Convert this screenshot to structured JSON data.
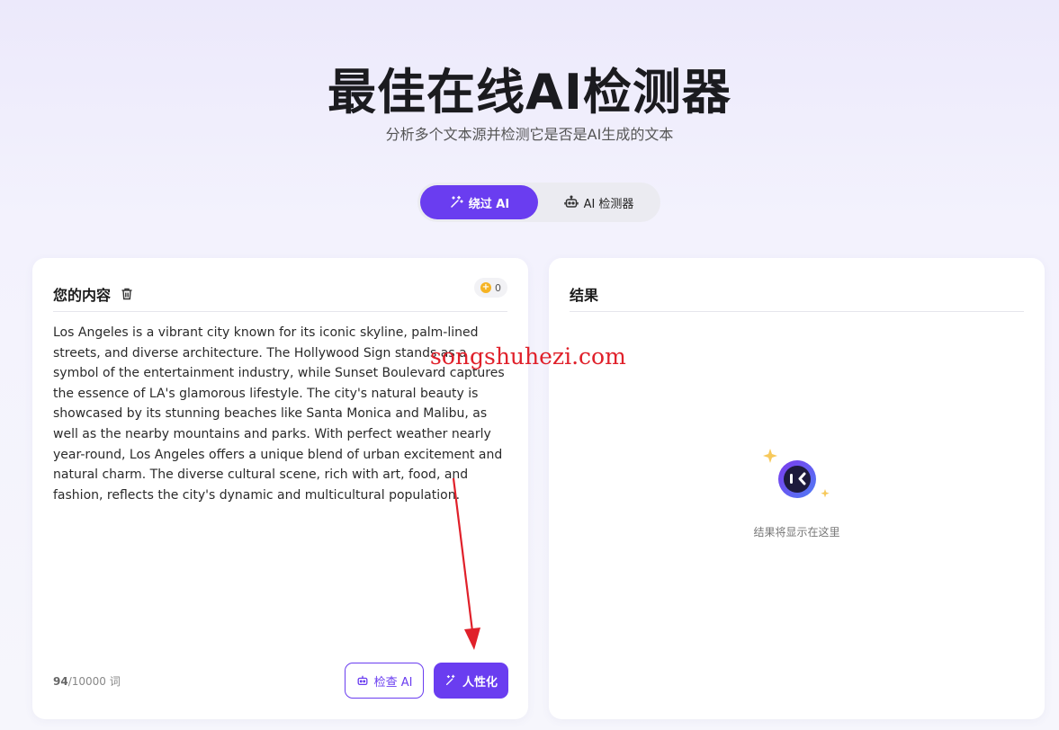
{
  "hero": {
    "title": "最佳在线AI检测器",
    "subtitle": "分析多个文本源并检测它是否是AI生成的文本"
  },
  "mode_toggle": {
    "bypass_label": "绕过 AI",
    "detector_label": "AI 检测器",
    "active": "bypass"
  },
  "input_card": {
    "title": "您的内容",
    "credits": "0",
    "text": "Los Angeles is a vibrant city known for its iconic skyline, palm-lined streets, and diverse architecture. The Hollywood Sign stands as a symbol of the entertainment industry, while Sunset Boulevard captures the essence of LA's glamorous lifestyle. The city's natural beauty is showcased by its stunning beaches like Santa Monica and Malibu, as well as the nearby mountains and parks. With perfect weather nearly year-round, Los Angeles offers a unique blend of urban excitement and natural charm. The diverse cultural scene, rich with art, food, and fashion, reflects the city's dynamic and multicultural population.",
    "word_count": "94",
    "word_limit": "/10000 词",
    "check_ai_label": "检查 AI",
    "humanize_label": "人性化"
  },
  "result_card": {
    "title": "结果",
    "empty_text": "结果将显示在这里"
  },
  "watermark": "songshuhezi.com",
  "colors": {
    "accent": "#6a3df0",
    "watermark": "#e0202a",
    "coin": "#f5b323"
  },
  "icons": {
    "bypass": "magic-wand-icon",
    "detector": "robot-icon",
    "trash": "trash-icon",
    "coin": "coin-icon"
  }
}
